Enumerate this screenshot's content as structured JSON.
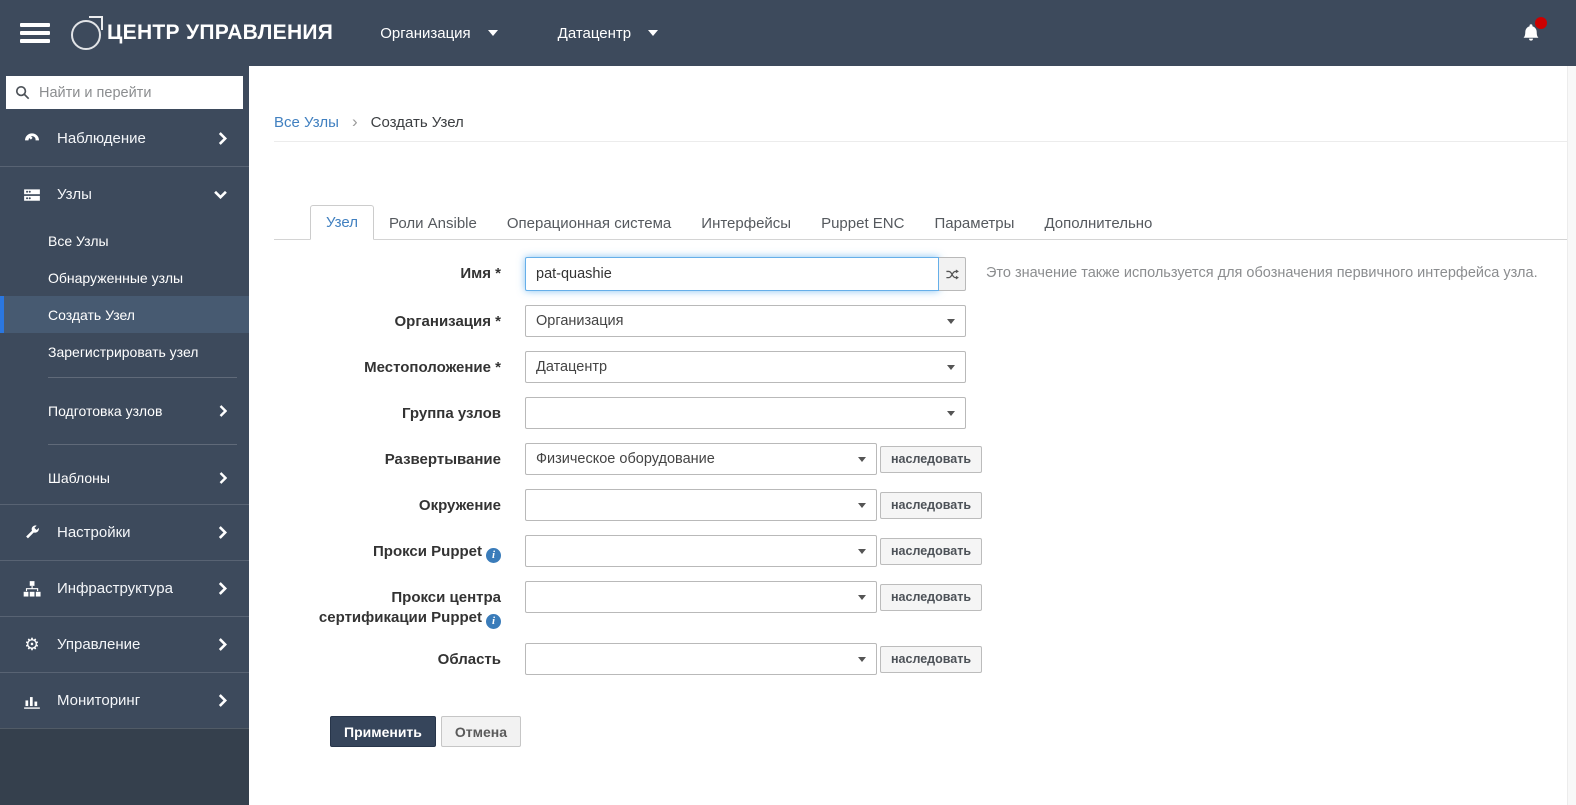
{
  "header": {
    "app_title": "ЦЕНТР УПРАВЛЕНИЯ",
    "organization": "Организация",
    "location": "Датацентр"
  },
  "sidebar": {
    "search_placeholder": "Найти и перейти",
    "observe": "Наблюдение",
    "nodes": "Узлы",
    "all_nodes": "Все Узлы",
    "discovered_nodes": "Обнаруженные узлы",
    "create_node": "Создать Узел",
    "register_node": "Зарегистрировать узел",
    "provisioning": "Подготовка узлов",
    "templates": "Шаблоны",
    "settings": "Настройки",
    "infrastructure": "Инфраструктура",
    "management": "Управление",
    "monitoring": "Мониторинг"
  },
  "breadcrumb": {
    "parent": "Все Узлы",
    "current": "Создать Узел"
  },
  "tabs": {
    "host": "Узел",
    "ansible_roles": "Роли Ansible",
    "os": "Операционная система",
    "interfaces": "Интерфейсы",
    "puppet_enc": "Puppet ENC",
    "parameters": "Параметры",
    "additional": "Дополнительно"
  },
  "form": {
    "name": {
      "label": "Имя *",
      "value": "pat-quashie",
      "help": "Это значение также используется для обозначения первичного интерфейса узла."
    },
    "organization": {
      "label": "Организация *",
      "value": "Организация"
    },
    "location": {
      "label": "Местоположение *",
      "value": "Датацентр"
    },
    "hostgroup": {
      "label": "Группа узлов",
      "value": ""
    },
    "deploy": {
      "label": "Развертывание",
      "value": "Физическое оборудование",
      "inherit": "наследовать"
    },
    "environment": {
      "label": "Окружение",
      "value": "",
      "inherit": "наследовать"
    },
    "puppet_proxy": {
      "label": "Прокси Puppet",
      "value": "",
      "inherit": "наследовать"
    },
    "puppet_ca_proxy": {
      "label": "Прокси центра сертификации Puppet",
      "value": "",
      "inherit": "наследовать"
    },
    "realm": {
      "label": "Область",
      "value": "",
      "inherit": "наследовать"
    },
    "submit": "Применить",
    "cancel": "Отмена"
  },
  "colors": {
    "header_bg": "#3d4a5c",
    "sidebar_active_bg": "#475a71",
    "active_indicator": "#2b77e0",
    "link_blue": "#4180c0",
    "notification_dot": "#cc0000",
    "primary_button_bg": "#36455b"
  }
}
